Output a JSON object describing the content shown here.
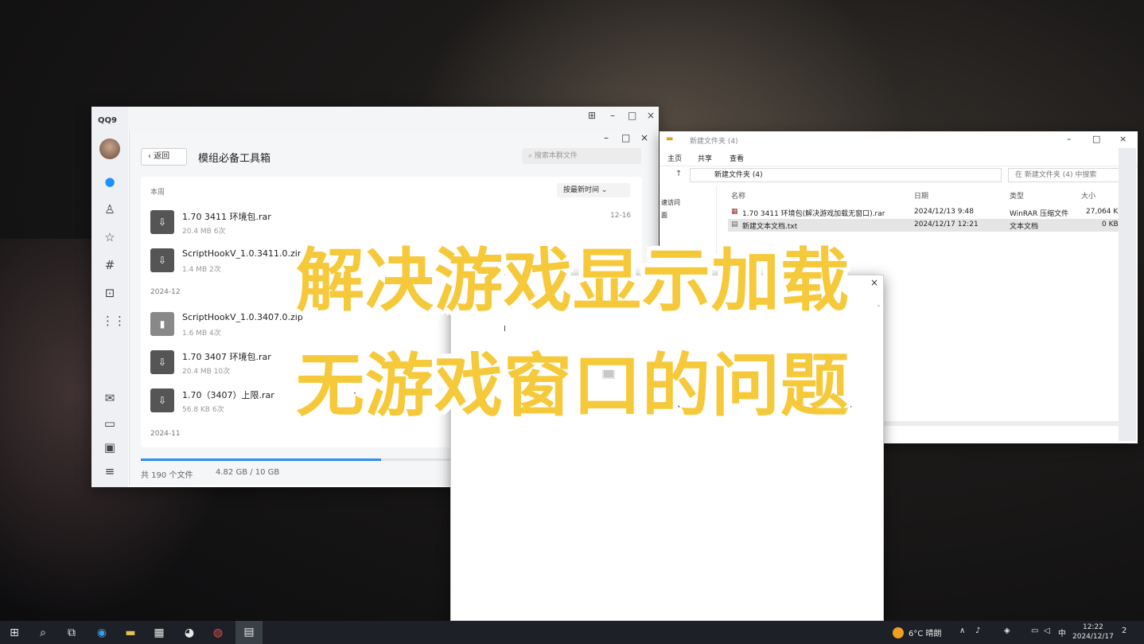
{
  "qq": {
    "logo": "QQ9",
    "panel_title": "模组必备工具箱",
    "back_label": "返回",
    "search_placeholder": "搜索本群文件",
    "sort_label": "按最新时间",
    "groups": [
      "本周",
      "2024-12",
      "2024-11"
    ],
    "files": [
      {
        "name": "1.70 3411 环境包.rar",
        "meta": "20.4 MB   6次",
        "date": "12-16",
        "sub": ""
      },
      {
        "name": "ScriptHookV_1.0.3411.0.zip",
        "meta": "1.4 MB   2次",
        "date": "",
        "sub": ""
      },
      {
        "name": "ScriptHookV_1.0.3407.0.zip",
        "meta": "1.6 MB   4次",
        "date": "",
        "sub": ""
      },
      {
        "name": "1.70 3407 环境包.rar",
        "meta": "20.4 MB   10次",
        "date": "",
        "sub": ""
      },
      {
        "name": "1.70（3407）上限.rar",
        "meta": "56.8 KB   6次",
        "date": "",
        "sub": ""
      }
    ],
    "footer_count": "共 190 个文件",
    "footer_storage": "4.82 GB / 10 GB",
    "storage_fraction": 0.48
  },
  "explorer": {
    "title": "新建文件夹 (4)",
    "tabs": [
      "主页",
      "共享",
      "查看"
    ],
    "address": "新建文件夹 (4)",
    "search_placeholder": "在 新建文件夹 (4) 中搜索",
    "nav": [
      "速访问",
      "面"
    ],
    "columns": {
      "name": "名称",
      "date": "日期",
      "type": "类型",
      "size": "大小"
    },
    "rows": [
      {
        "name": "1.70 3411 环境包(解决游戏加载无窗口).rar",
        "date": "2024/12/13 9:48",
        "type": "WinRAR 压缩文件",
        "size": "27,064 KB"
      },
      {
        "name": "新建文本文档.txt",
        "date": "2024/12/17 12:21",
        "type": "文本文档",
        "size": "0 KB"
      }
    ]
  },
  "caption": {
    "line1": "解决游戏显示加载",
    "line2": "无游戏窗口的问题"
  },
  "taskbar": {
    "weather": "6°C 晴朗",
    "ime": "中",
    "time": "12:22",
    "date": "2024/12/17",
    "notify": "2"
  }
}
